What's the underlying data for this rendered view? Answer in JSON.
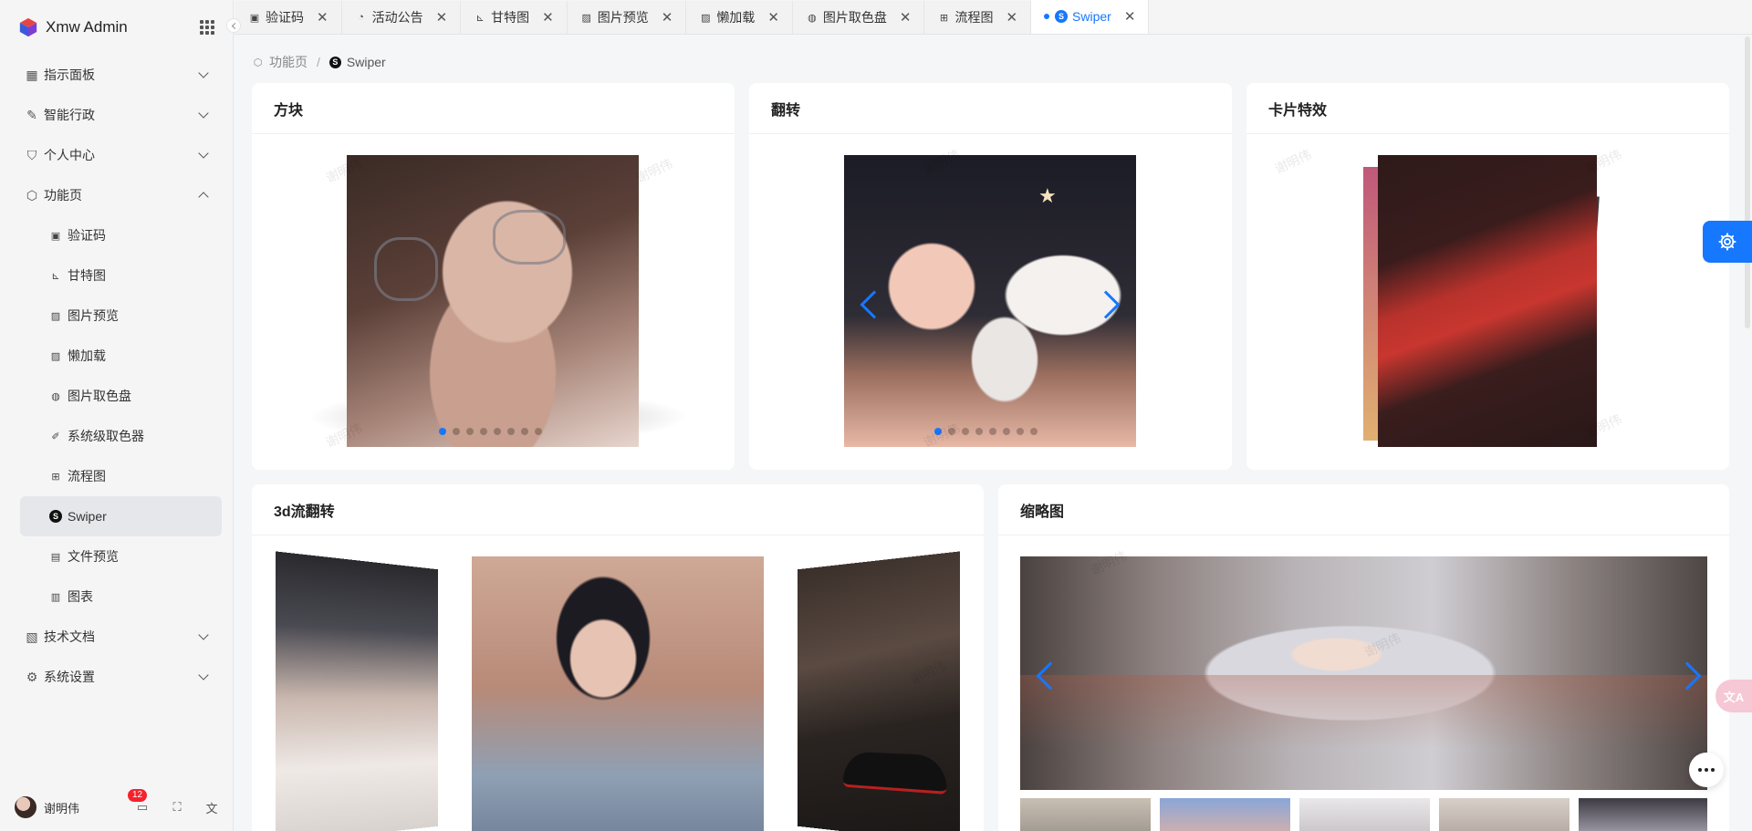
{
  "app": {
    "title": "Xmw Admin"
  },
  "sidebar": {
    "menu": [
      {
        "label": "指示面板",
        "icon": "grid-icon",
        "expanded": false
      },
      {
        "label": "智能行政",
        "icon": "pen-icon",
        "expanded": false
      },
      {
        "label": "个人中心",
        "icon": "shield-icon",
        "expanded": false
      },
      {
        "label": "功能页",
        "icon": "cube-icon",
        "expanded": true
      }
    ],
    "submenu": [
      {
        "label": "验证码",
        "icon": "terminal-icon"
      },
      {
        "label": "甘特图",
        "icon": "gantt-icon"
      },
      {
        "label": "图片预览",
        "icon": "image-icon"
      },
      {
        "label": "懒加载",
        "icon": "image-lazy-icon"
      },
      {
        "label": "图片取色盘",
        "icon": "palette-icon"
      },
      {
        "label": "系统级取色器",
        "icon": "eyedropper-icon"
      },
      {
        "label": "流程图",
        "icon": "flow-icon"
      },
      {
        "label": "Swiper",
        "icon": "swiper-icon",
        "active": true
      },
      {
        "label": "文件预览",
        "icon": "file-icon"
      },
      {
        "label": "图表",
        "icon": "bar-chart-icon"
      }
    ],
    "menu_bottom": [
      {
        "label": "技术文档",
        "icon": "doc-icon"
      },
      {
        "label": "系统设置",
        "icon": "gear-icon"
      }
    ],
    "footer": {
      "username": "谢明伟",
      "notification_count": "12"
    }
  },
  "tabs": [
    {
      "label": "验证码",
      "icon": "terminal-icon"
    },
    {
      "label": "活动公告",
      "icon": "bell-icon"
    },
    {
      "label": "甘特图",
      "icon": "gantt-icon"
    },
    {
      "label": "图片预览",
      "icon": "image-icon"
    },
    {
      "label": "懒加载",
      "icon": "image-lazy-icon"
    },
    {
      "label": "图片取色盘",
      "icon": "palette-icon"
    },
    {
      "label": "流程图",
      "icon": "flow-icon"
    },
    {
      "label": "Swiper",
      "icon": "swiper-icon",
      "active": true
    }
  ],
  "breadcrumb": {
    "parent": "功能页",
    "current": "Swiper"
  },
  "cards": {
    "cube": {
      "title": "方块"
    },
    "flip": {
      "title": "翻转"
    },
    "cards": {
      "title": "卡片特效"
    },
    "coverflow": {
      "title": "3d流翻转"
    },
    "thumbs": {
      "title": "缩略图"
    }
  },
  "watermark": "谢明伟",
  "colors": {
    "accent": "#1677ff",
    "badge": "#f5222d"
  }
}
